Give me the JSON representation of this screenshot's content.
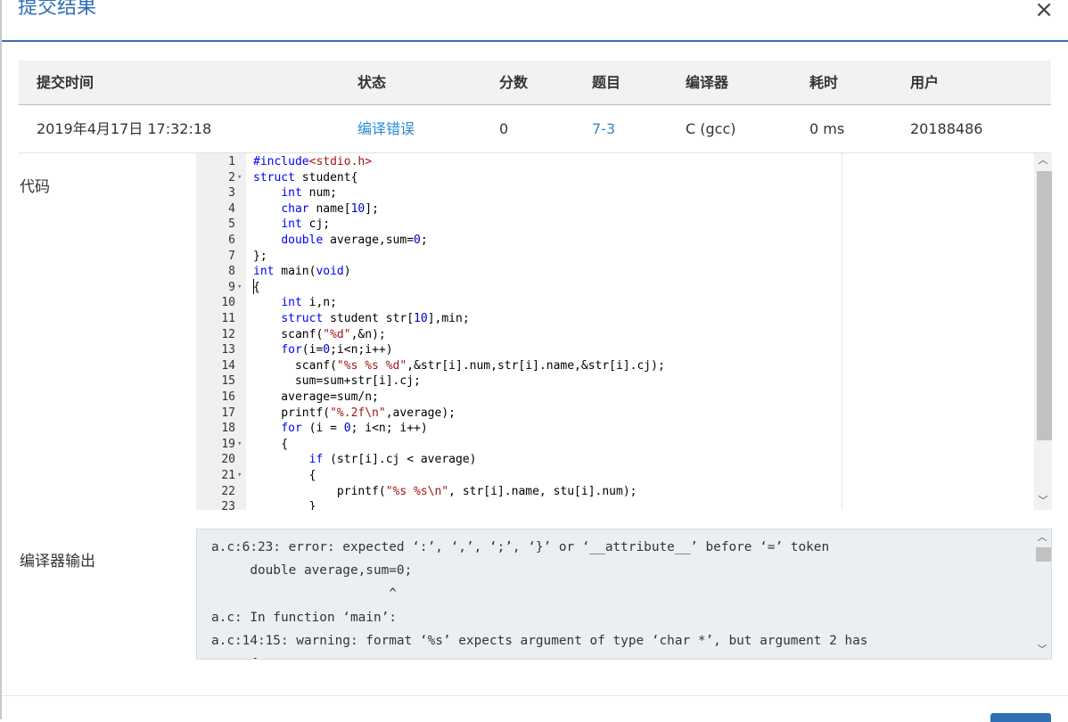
{
  "modal": {
    "title": "提交结果",
    "close_label": "×"
  },
  "table": {
    "headers": [
      "提交时间",
      "状态",
      "分数",
      "题目",
      "编译器",
      "耗时",
      "用户"
    ],
    "row": {
      "time": "2019年4月17日 17:32:18",
      "status": "编译错误",
      "score": "0",
      "problem": "7-3",
      "compiler": "C (gcc)",
      "duration": "0 ms",
      "user": "20188486"
    }
  },
  "labels": {
    "code": "代码",
    "compiler_output": "编译器输出"
  },
  "code_lines": [
    "#include<stdio.h>",
    "struct student{",
    "    int num;",
    "    char name[10];",
    "    int cj;",
    "    double average,sum=0;",
    "};",
    "int main(void)",
    "{",
    "    int i,n;",
    "    struct student str[10],min;",
    "    scanf(\"%d\",&n);",
    "    for(i=0;i<n;i++)",
    "      scanf(\"%s %s %d\",&str[i].num,str[i].name,&str[i].cj);",
    "      sum=sum+str[i].cj;",
    "    average=sum/n;",
    "    printf(\"%.2f\\n\",average);",
    "    for (i = 0; i<n; i++)",
    "    {",
    "        if (str[i].cj < average)",
    "        {",
    "            printf(\"%s %s\\n\", str[i].name, stu[i].num);",
    "        }"
  ],
  "line_numbers": [
    "1",
    "2",
    "3",
    "4",
    "5",
    "6",
    "7",
    "8",
    "9",
    "10",
    "11",
    "12",
    "13",
    "14",
    "15",
    "16",
    "17",
    "18",
    "19",
    "20",
    "21",
    "22",
    "23"
  ],
  "fold_markers": {
    "2": "▾",
    "9": "▾",
    "19": "▾",
    "21": "▾"
  },
  "compiler_output_lines": [
    "a.c:6:23: error: expected ‘:’, ‘,’, ‘;’, ‘}’ or ‘__attribute__’ before ‘=’ token",
    "     double average,sum=0;",
    "                       ^",
    "a.c: In function ‘main’:",
    "a.c:14:15: warning: format ‘%s’ expects argument of type ‘char *’, but argument 2 has",
    "     {"
  ],
  "colors": {
    "accent": "#2f6fb5",
    "link": "#2a8bd4",
    "keyword": "#0000ff",
    "string": "#a31515"
  }
}
